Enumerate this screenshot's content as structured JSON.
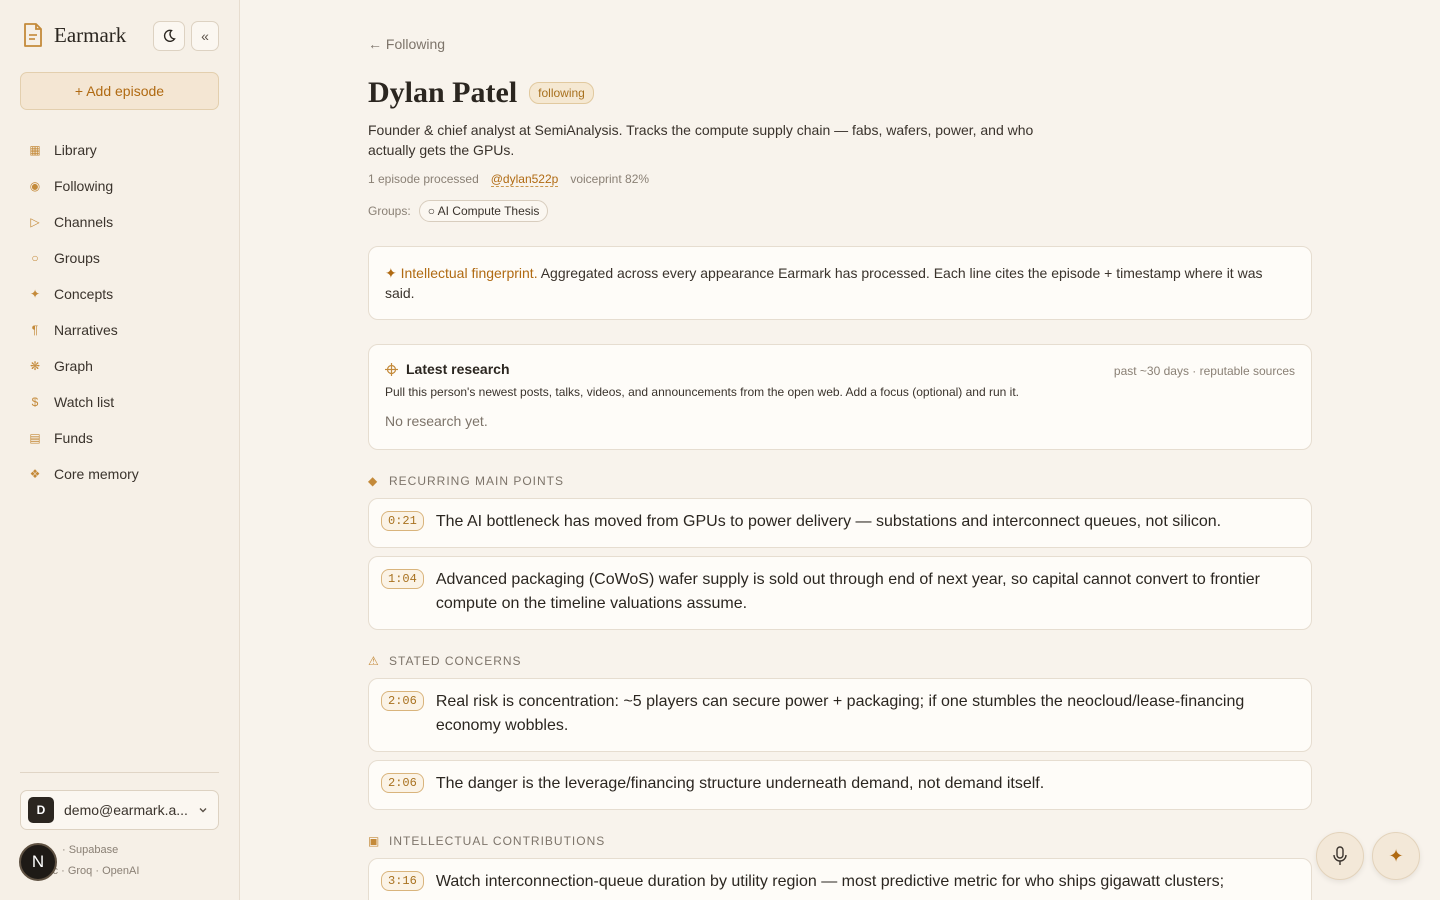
{
  "sidebar": {
    "brand": "Earmark",
    "theme_toggle_icon": "moon-icon",
    "collapse_label": "«",
    "add_episode": "+ Add episode",
    "nav": [
      {
        "label": "Library",
        "icon": "grid-icon",
        "glyph": "▦"
      },
      {
        "label": "Following",
        "icon": "target-icon",
        "glyph": "◉"
      },
      {
        "label": "Channels",
        "icon": "play-icon",
        "glyph": "▷"
      },
      {
        "label": "Groups",
        "icon": "circle-icon",
        "glyph": "○"
      },
      {
        "label": "Concepts",
        "icon": "sparkle-icon",
        "glyph": "✦"
      },
      {
        "label": "Narratives",
        "icon": "pilcrow-icon",
        "glyph": "¶"
      },
      {
        "label": "Graph",
        "icon": "asterisk-icon",
        "glyph": "❋"
      },
      {
        "label": "Watch list",
        "icon": "dollar-icon",
        "glyph": "$"
      },
      {
        "label": "Funds",
        "icon": "ledger-icon",
        "glyph": "▤"
      },
      {
        "label": "Core memory",
        "icon": "diamond-cluster-icon",
        "glyph": "❖"
      }
    ],
    "account": {
      "initial": "D",
      "email": "demo@earmark.a..."
    },
    "footer_line1": "· Supabase",
    "footer_line2": "pic · Groq · OpenAI",
    "badge": "N"
  },
  "main": {
    "back": "← Following",
    "name": "Dylan Patel",
    "status_pill": "following",
    "bio": "Founder & chief analyst at SemiAnalysis. Tracks the compute supply chain — fabs, wafers, power, and who actually gets the GPUs.",
    "episodes_processed": "1 episode processed",
    "handle": "@dylan522p",
    "voiceprint": "voiceprint 82%",
    "groups_label": "Groups:",
    "group": "○ AI Compute Thesis",
    "fingerprint": {
      "label": "✦ Intellectual fingerprint.",
      "text": " Aggregated across every appearance Earmark has processed. Each line cites the episode + timestamp where it was said."
    },
    "research": {
      "title": "Latest research",
      "meta": "past ~30 days · reputable sources",
      "description": "Pull this person's newest posts, talks, videos, and announcements from the open web. Add a focus (optional) and run it.",
      "empty": "No research yet."
    },
    "sections": {
      "recurring": {
        "title": "RECURRING MAIN POINTS",
        "items": [
          {
            "ts": "0:21",
            "text": "The AI bottleneck has moved from GPUs to power delivery — substations and interconnect queues, not silicon."
          },
          {
            "ts": "1:04",
            "text": "Advanced packaging (CoWoS) wafer supply is sold out through end of next year, so capital cannot convert to frontier compute on the timeline valuations assume."
          }
        ]
      },
      "concerns": {
        "title": "STATED CONCERNS",
        "items": [
          {
            "ts": "2:06",
            "text": "Real risk is concentration: ~5 players can secure power + packaging; if one stumbles the neocloud/lease-financing economy wobbles."
          },
          {
            "ts": "2:06",
            "text": "The danger is the leverage/financing structure underneath demand, not demand itself."
          }
        ]
      },
      "contributions": {
        "title": "INTELLECTUAL CONTRIBUTIONS",
        "items": [
          {
            "ts": "3:16",
            "text": "Watch interconnection-queue duration by utility region — most predictive metric for who ships gigawatt clusters;"
          }
        ]
      }
    }
  },
  "colors": {
    "accent": "#b06a12",
    "background": "#f8f3ec",
    "card": "#fefcf8"
  }
}
